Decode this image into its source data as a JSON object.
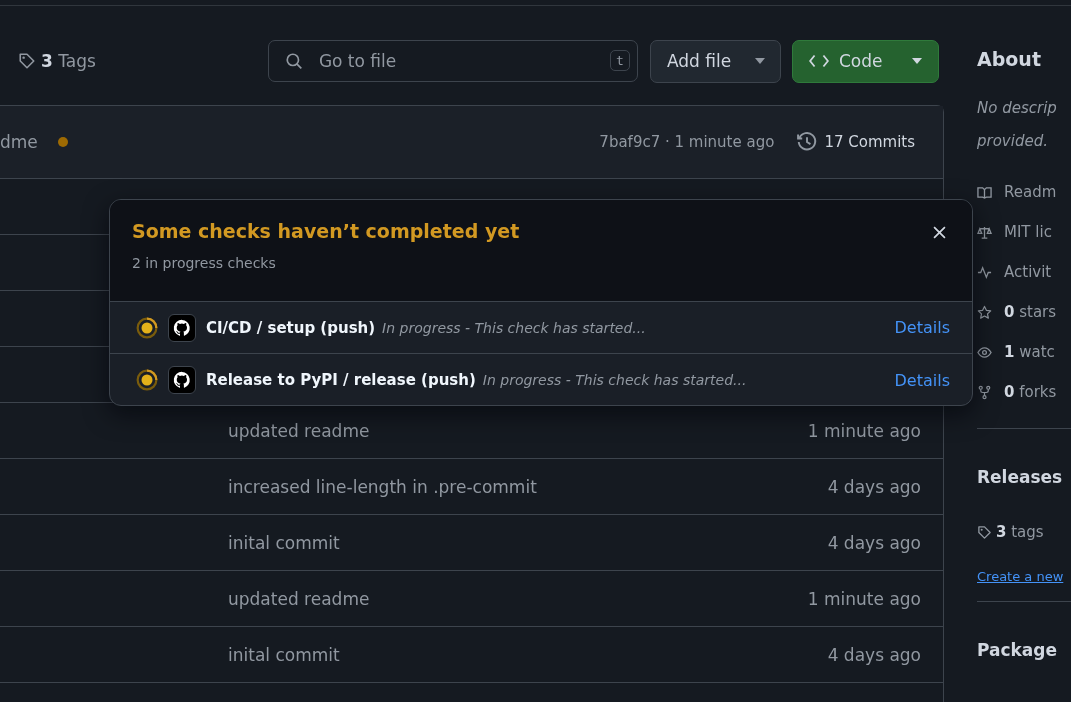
{
  "toolbar": {
    "tags": {
      "count": "3",
      "label": "Tags"
    },
    "search": {
      "placeholder": "Go to file",
      "shortcut": "t"
    },
    "add_file": "Add file",
    "code": "Code"
  },
  "latest_commit": {
    "message": "dme",
    "pending": true,
    "hash_time": "7baf9c7 · 1 minute ago",
    "commits": "17 Commits"
  },
  "files": [
    {
      "message": "updated readme",
      "time": "1 minute ago"
    },
    {
      "message": "increased line-length in .pre-commit",
      "time": "4 days ago"
    },
    {
      "message": "inital commit",
      "time": "4 days ago"
    },
    {
      "message": "updated readme",
      "time": "1 minute ago"
    },
    {
      "message": "inital commit",
      "time": "4 days ago"
    }
  ],
  "checks_popup": {
    "title": "Some checks haven’t completed yet",
    "subtitle": "2 in progress checks",
    "checks": [
      {
        "name": "CI/CD / setup (push)",
        "in_progress": true,
        "description": "In progress - This check has started...",
        "link": "Details"
      },
      {
        "name": "Release to PyPI / release (push)",
        "in_progress": true,
        "description": "In progress - This check has started...",
        "link": "Details"
      }
    ]
  },
  "sidebar": {
    "about": {
      "title": "About",
      "description": [
        "No descrip",
        "provided."
      ]
    },
    "stats": [
      {
        "kind": "readme",
        "label": "Readm"
      },
      {
        "kind": "license",
        "label": "MIT lic"
      },
      {
        "kind": "activity",
        "label": "Activit"
      },
      {
        "kind": "stars",
        "count": "0",
        "label": "stars"
      },
      {
        "kind": "watchers",
        "count": "1",
        "label": "watc"
      },
      {
        "kind": "forks",
        "count": "0",
        "label": "forks"
      }
    ],
    "releases": {
      "title": "Releases",
      "tags": {
        "count": "3",
        "label": "tags"
      },
      "link": "Create a new"
    },
    "packages": {
      "title": "Package"
    }
  }
}
